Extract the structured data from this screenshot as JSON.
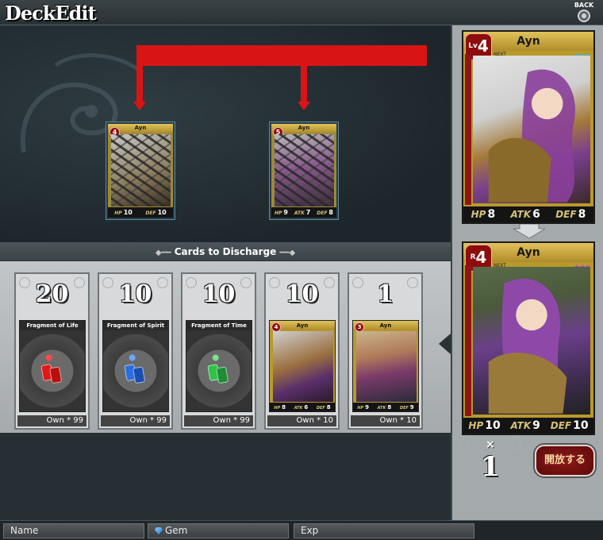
{
  "app": {
    "title": "DeckEdit",
    "back_label": "BACK"
  },
  "target_cards": [
    {
      "name": "Ayn",
      "level": "4",
      "stars": "★★★",
      "hp": "10",
      "atk": "",
      "def": "10",
      "locked": true
    },
    {
      "name": "Ayn",
      "level": "5",
      "stars": "★★★",
      "hp": "9",
      "atk": "7",
      "def": "8",
      "locked": true
    }
  ],
  "discharge": {
    "header": "Cards to Discharge",
    "slots": [
      {
        "count": "20",
        "title": "Fragment of Life",
        "own": "Own * 99",
        "gem_color": "#e01818"
      },
      {
        "count": "10",
        "title": "Fragment of Spirit",
        "own": "Own * 99",
        "gem_color": "#2a6ee0"
      },
      {
        "count": "10",
        "title": "Fragment of Time",
        "own": "Own * 99",
        "gem_color": "#2fc24a"
      },
      {
        "count": "10",
        "title": "Ayn",
        "own": "Own * 10",
        "level": "4",
        "hp": "8",
        "atk": "6",
        "def": "8"
      },
      {
        "count": "1",
        "title": "Ayn",
        "own": "Own * 10",
        "level": "3",
        "hp": "9",
        "atk": "8",
        "def": "9"
      }
    ]
  },
  "preview": {
    "current": {
      "prefix": "Lv",
      "level": "4",
      "name": "Ayn",
      "next": "NEXT",
      "stars": "★★★",
      "hp": "8",
      "atk": "6",
      "def": "8"
    },
    "result": {
      "prefix": "R",
      "level": "4",
      "name": "Ayn",
      "next": "NEXT",
      "stars": "★★★",
      "hp": "10",
      "atk": "9",
      "def": "10"
    },
    "labels": {
      "hp": "HP",
      "atk": "ATK",
      "def": "DEF"
    },
    "multiplier": "×",
    "count": "1",
    "release_button": "開放する"
  },
  "status_bar": {
    "name_label": "Name",
    "gem_label": "Gem",
    "exp_label": "Exp"
  },
  "colors": {
    "accent_red": "#d91414",
    "panel_dark": "#1f2a2f",
    "gold": "#b8992c"
  }
}
